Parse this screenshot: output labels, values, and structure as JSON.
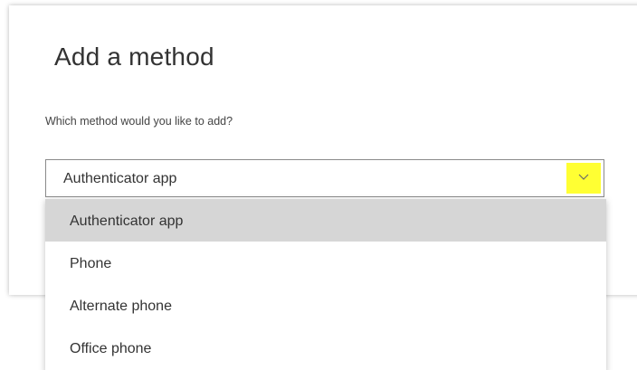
{
  "dialog": {
    "title": "Add a method",
    "prompt": "Which method would you like to add?"
  },
  "method_select": {
    "selected_value": "Authenticator app",
    "expand_icon": "chevron-down-icon",
    "highlight_color": "#ffff33",
    "options": [
      {
        "label": "Authenticator app",
        "selected": true
      },
      {
        "label": "Phone",
        "selected": false
      },
      {
        "label": "Alternate phone",
        "selected": false
      },
      {
        "label": "Office phone",
        "selected": false
      }
    ]
  }
}
